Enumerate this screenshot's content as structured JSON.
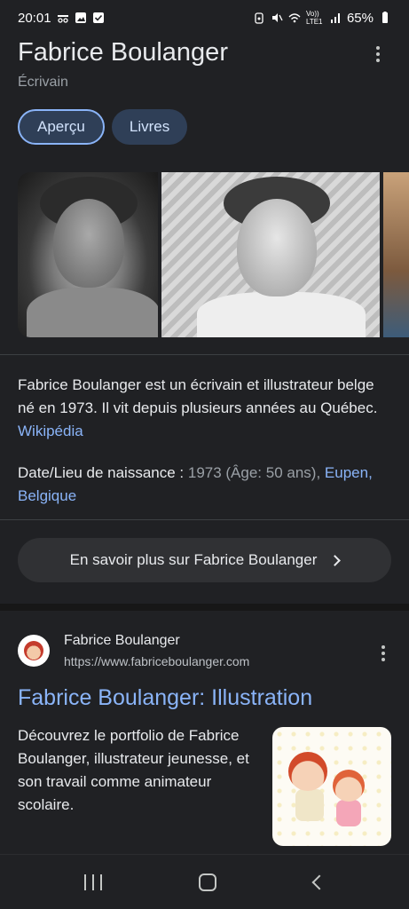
{
  "status_bar": {
    "time": "20:01",
    "battery": "65%",
    "network": "Vo)) LTE1"
  },
  "header": {
    "title": "Fabrice Boulanger",
    "subtitle": "Écrivain"
  },
  "tabs": [
    {
      "label": "Aperçu",
      "active": true
    },
    {
      "label": "Livres",
      "active": false
    }
  ],
  "description": {
    "text": "Fabrice Boulanger est un écrivain et illustrateur belge né en 1973. Il vit depuis plusieurs années au Québec.",
    "source_link": "Wikipédia"
  },
  "birth": {
    "label": "Date/Lieu de naissance :",
    "value": "1973 (Âge: 50 ans),",
    "place_link": "Eupen, Belgique"
  },
  "more_button": {
    "label": "En savoir plus sur Fabrice Boulanger"
  },
  "result": {
    "site_name": "Fabrice Boulanger",
    "url": "https://www.fabriceboulanger.com",
    "title": "Fabrice Boulanger: Illustration",
    "snippet": "Découvrez le portfolio de Fabrice Boulanger, illustrateur jeunesse, et son travail comme animateur scolaire."
  },
  "colors": {
    "background": "#202124",
    "link": "#8ab4f8",
    "tab_bg": "#2f3f57",
    "button_bg": "#303134"
  }
}
